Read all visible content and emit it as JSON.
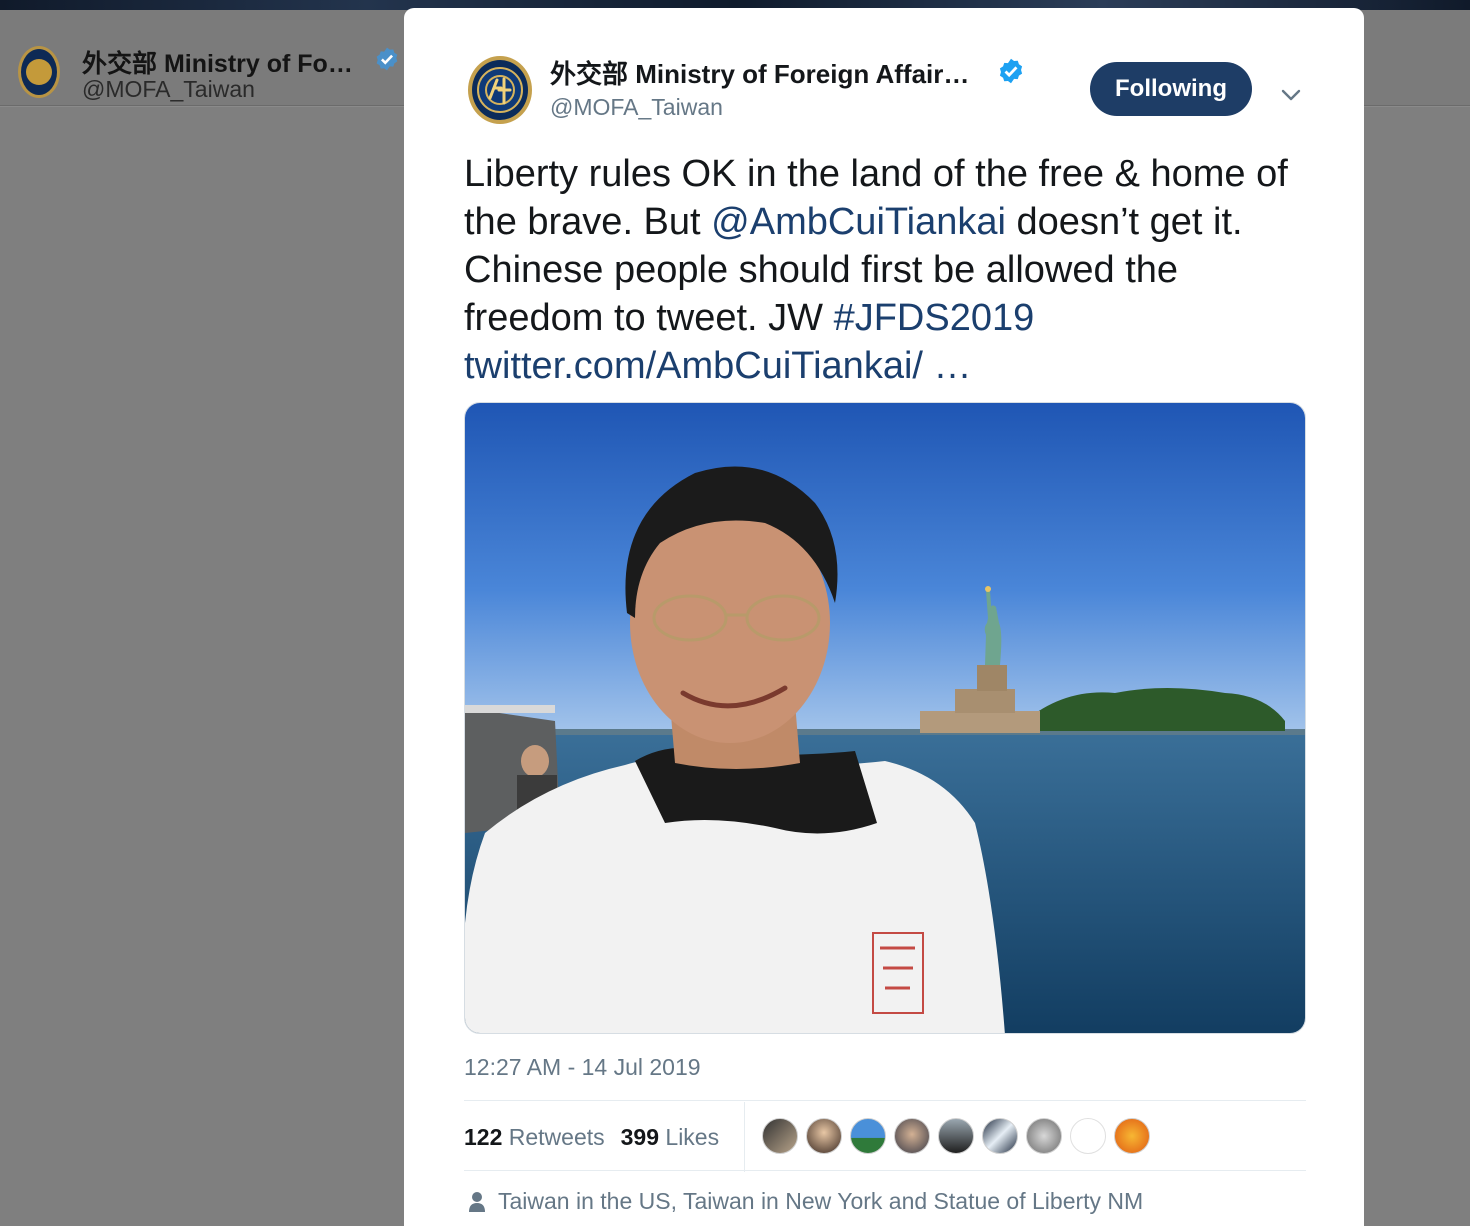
{
  "background": {
    "account_name": "外交部 Ministry of Fo…",
    "account_handle": "@MOFA_Taiwan"
  },
  "tweet": {
    "account_name": "外交部 Ministry of Foreign Affair…",
    "account_handle": "@MOFA_Taiwan",
    "follow_button": "Following",
    "text": {
      "part1": "Liberty rules OK in the land of the free & home of the brave. But ",
      "mention": "@AmbCuiTiankai",
      "part2": " doesn’t get it. Chinese people should first be allowed the freedom to tweet. JW ",
      "hashtag": "#JFDS2019",
      "space": " ",
      "url": "twitter.com/AmbCuiTiankai/ …"
    },
    "timestamp": "12:27 AM - 14 Jul 2019",
    "retweets": {
      "count": "122",
      "label": "Retweets"
    },
    "likes": {
      "count": "399",
      "label": "Likes"
    },
    "location": "Taiwan in the US, Taiwan in New York and Statue of Liberty NM"
  },
  "colors": {
    "accent": "#1e3d66",
    "link": "#1b3f6e",
    "verified": "#1da1f2",
    "muted": "#657786"
  },
  "icons": {
    "verified": "verified-badge-icon",
    "chevron": "chevron-down-icon",
    "location": "person-pin-icon"
  }
}
